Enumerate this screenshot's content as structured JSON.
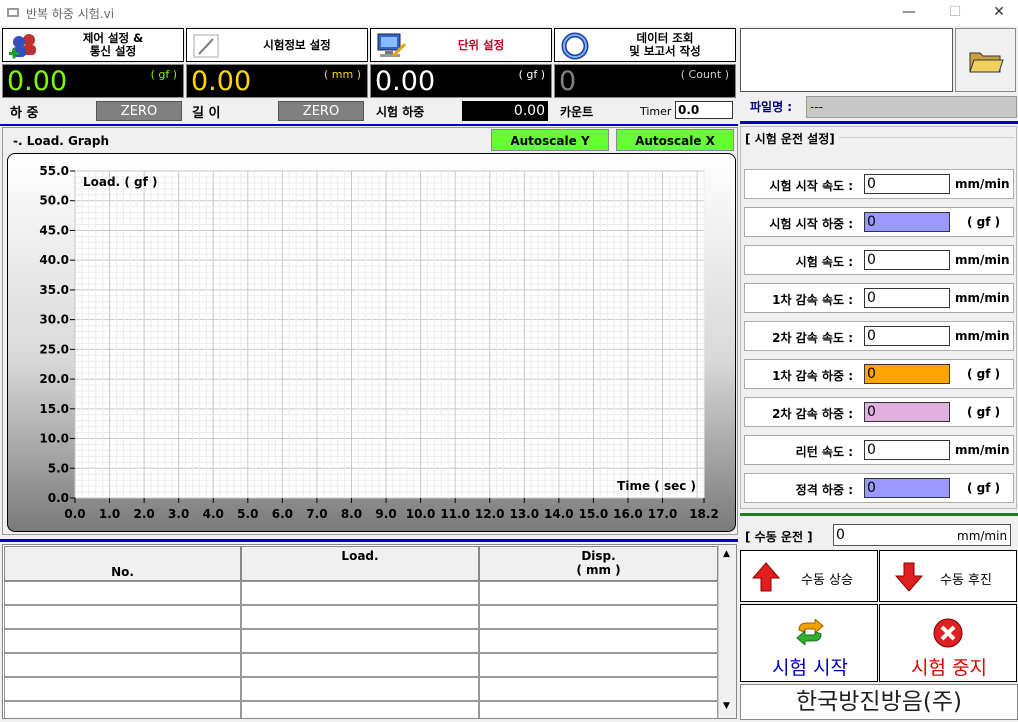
{
  "window": {
    "title": "반복 하중 시험.vi",
    "min": "—",
    "max": "☐",
    "close": "✕"
  },
  "toolbar": [
    {
      "name": "control-settings",
      "label": "제어 설정 &\n통신 설정"
    },
    {
      "name": "test-info",
      "label": "시험정보 설정"
    },
    {
      "name": "unit-settings",
      "label": "단위 설정",
      "color": "#c00020"
    },
    {
      "name": "data-report",
      "label": "데이터 조회\n및 보고서 작성"
    }
  ],
  "displays": {
    "load": {
      "value": "0.00",
      "unit": "( gf )",
      "label": "하 중",
      "zero": "ZERO",
      "color": "#7cfc00"
    },
    "length": {
      "value": "0.00",
      "unit": "( mm )",
      "label": "길 이",
      "zero": "ZERO",
      "color": "#ffd700"
    },
    "test_load": {
      "value": "0.00",
      "unit": "( gf )",
      "label": "시험 하중",
      "sub_value": "0.00",
      "color": "#ffffff"
    },
    "count": {
      "value": "0",
      "unit": "( Count )",
      "label": "카운트",
      "timer_label": "Timer",
      "timer_value": "0.0",
      "color": "#808080"
    }
  },
  "file": {
    "label": "파일명 :",
    "value": "---"
  },
  "graph": {
    "title": "-. Load. Graph",
    "autoscale_y": "Autoscale Y",
    "autoscale_x": "Autoscale X",
    "accent": "#66ff33"
  },
  "chart_data": {
    "type": "line",
    "ylabel": "Load. ( gf )",
    "xlabel": "Time ( sec )",
    "ylim": [
      0,
      55
    ],
    "xlim": [
      0,
      18.2
    ],
    "yticks": [
      "55.0",
      "50.0",
      "45.0",
      "40.0",
      "35.0",
      "30.0",
      "25.0",
      "20.0",
      "15.0",
      "10.0",
      "5.0",
      "0.0"
    ],
    "xticks": [
      "0.0",
      "1.0",
      "2.0",
      "3.0",
      "4.0",
      "5.0",
      "6.0",
      "7.0",
      "8.0",
      "9.0",
      "10.0",
      "11.0",
      "12.0",
      "13.0",
      "14.0",
      "15.0",
      "16.0",
      "17.0",
      "18.2"
    ],
    "grid": true,
    "series": []
  },
  "table": {
    "headers": [
      "No.",
      "Load.",
      "Disp.\n( mm )"
    ]
  },
  "settings": {
    "title": "[ 시험 운전 설정]",
    "rows": [
      {
        "label": "시험 시작  속도 :",
        "value": "0",
        "unit": "mm/min",
        "bg": "#ffffff"
      },
      {
        "label": "시험 시작 하중 :",
        "value": "0",
        "unit": "( gf )",
        "bg": "#9999ff"
      },
      {
        "label": "시험 속도 :",
        "value": "0",
        "unit": "mm/min",
        "bg": "#ffffff"
      },
      {
        "label": "1차 감속 속도 :",
        "value": "0",
        "unit": "mm/min",
        "bg": "#ffffff"
      },
      {
        "label": "2차 감속 속도 :",
        "value": "0",
        "unit": "mm/min",
        "bg": "#ffffff"
      },
      {
        "label": "1차 감속 하중 :",
        "value": "0",
        "unit": "( gf )",
        "bg": "#ffa500"
      },
      {
        "label": "2차 감속 하중 :",
        "value": "0",
        "unit": "( gf )",
        "bg": "#e0b0e0"
      },
      {
        "label": "리턴 속도 :",
        "value": "0",
        "unit": "mm/min",
        "bg": "#ffffff"
      },
      {
        "label": "정격 하중 :",
        "value": "0",
        "unit": "( gf )",
        "bg": "#9999ff"
      }
    ]
  },
  "manual": {
    "label": "[ 수동 운전 ]",
    "value": "0",
    "unit": "mm/min",
    "up": "수동 상승",
    "back": "수동 후진"
  },
  "run": {
    "start": "시험 시작",
    "stop": "시험 중지",
    "stop_color": "#e00000",
    "start_color": "#0000c0"
  },
  "company": "한국방진방음(주)"
}
